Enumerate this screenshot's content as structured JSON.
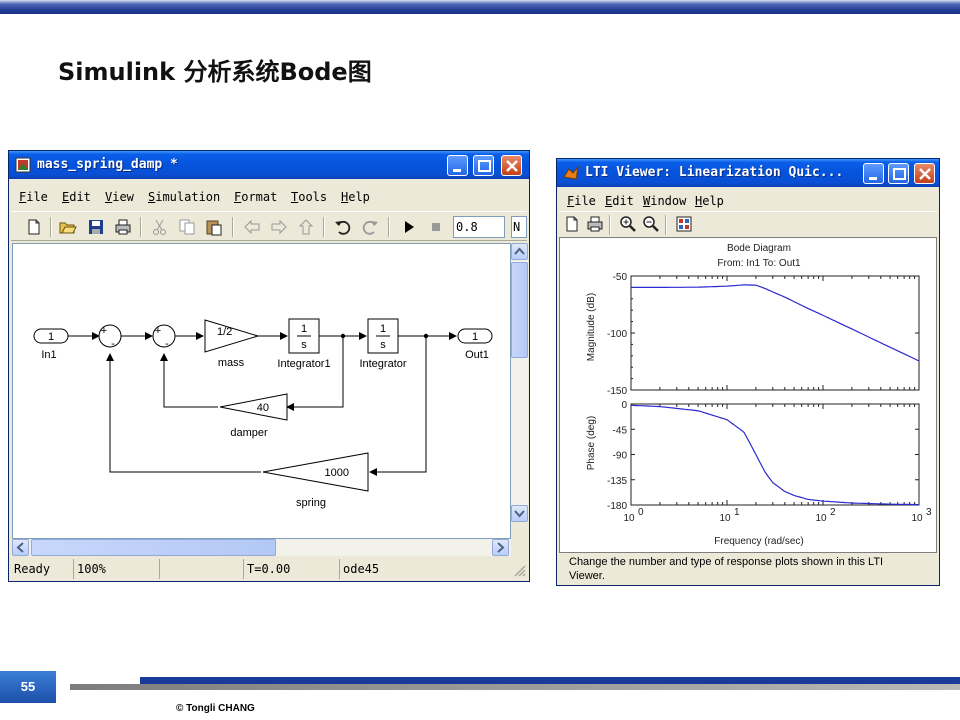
{
  "slide": {
    "title": "Simulink 分析系统Bode图",
    "page_number": "55",
    "copyright": "© Tongli  CHANG"
  },
  "colors": {
    "title_bar": "#0453dc",
    "band": "#17308a",
    "plot_line": "#2a2ad0"
  },
  "simulink": {
    "title": "mass_spring_damp *",
    "menu": [
      "File",
      "Edit",
      "View",
      "Simulation",
      "Format",
      "Tools",
      "Help"
    ],
    "toolbar_icons": [
      "new-file-icon",
      "open-folder-icon",
      "save-icon",
      "print-icon",
      "cut-icon",
      "copy-icon",
      "paste-icon",
      "back-arrow-icon",
      "forward-arrow-icon",
      "up-arrow-icon",
      "undo-icon",
      "redo-icon",
      "play-icon",
      "stop-icon"
    ],
    "stop_time": "0.8",
    "mode_label": "N",
    "blocks": {
      "in1_value": "1",
      "in1_label": "In1",
      "sum_sign_plus": "+",
      "sum_sign_minus": "-",
      "gain_mass_value": "1/2",
      "gain_mass_label": "mass",
      "int_num": "1",
      "int_den": "s",
      "integrator1_label": "Integrator1",
      "integrator_label": "Integrator",
      "out1_value": "1",
      "out1_label": "Out1",
      "damper_value": "40",
      "damper_label": "damper",
      "spring_value": "1000",
      "spring_label": "spring"
    },
    "status": {
      "state": "Ready",
      "zoom": "100%",
      "empty": "",
      "time": "T=0.00",
      "solver": "ode45"
    }
  },
  "lti": {
    "title": "LTI Viewer: Linearization Quic...",
    "menu": [
      "File",
      "Edit",
      "Window",
      "Help"
    ],
    "toolbar_icons": [
      "new-file-icon",
      "print-icon",
      "zoom-in-icon",
      "zoom-out-icon",
      "grid-config-icon"
    ],
    "status_text": "Change the number and type of response plots shown in this LTI Viewer."
  },
  "chart_data": [
    {
      "type": "line",
      "title": "Bode Diagram",
      "subtitle": "From: In1  To: Out1",
      "xlabel": "Frequency  (rad/sec)",
      "ylabel": "Magnitude (dB)",
      "xscale": "log",
      "xlim": [
        1,
        1000
      ],
      "ylim": [
        -150,
        -50
      ],
      "x_ticks": [
        "10^0",
        "10^1",
        "10^2",
        "10^3"
      ],
      "y_ticks": [
        "-50",
        "-100",
        "-150"
      ],
      "x": [
        1,
        2,
        5,
        10,
        15,
        20,
        25,
        30,
        40,
        50,
        70,
        100,
        200,
        500,
        1000
      ],
      "values": [
        -60,
        -60,
        -59.8,
        -58.9,
        -57.8,
        -58,
        -61,
        -64,
        -68.5,
        -72.5,
        -78.5,
        -84.5,
        -96.5,
        -112.5,
        -124.5
      ],
      "grid": false
    },
    {
      "type": "line",
      "ylabel": "Phase (deg)",
      "xscale": "log",
      "xlim": [
        1,
        1000
      ],
      "ylim": [
        -180,
        0
      ],
      "x_ticks": [
        "10^0",
        "10^1",
        "10^2",
        "10^3"
      ],
      "y_ticks": [
        "0",
        "-45",
        "-90",
        "-135",
        "-180"
      ],
      "x": [
        1,
        2,
        5,
        10,
        15,
        20,
        25,
        30,
        40,
        50,
        70,
        100,
        200,
        500,
        1000
      ],
      "values": [
        -2.3,
        -4.6,
        -12,
        -28,
        -50,
        -90,
        -122,
        -140,
        -156,
        -163,
        -170,
        -173,
        -176.5,
        -178.5,
        -179.3
      ],
      "grid": false
    }
  ]
}
